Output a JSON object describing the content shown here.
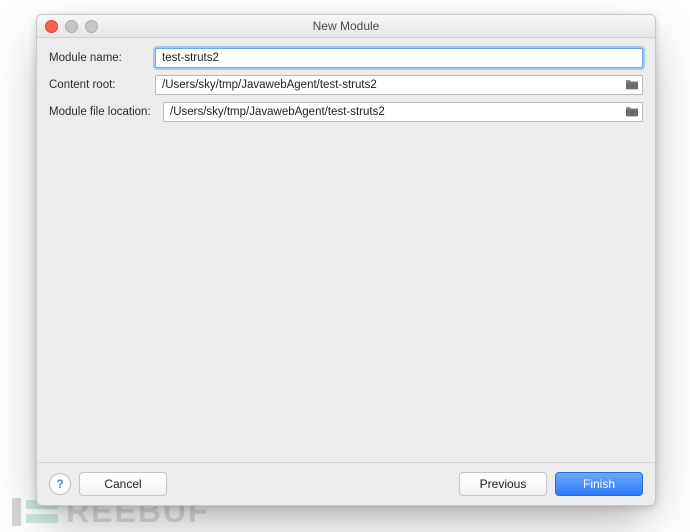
{
  "window": {
    "title": "New Module"
  },
  "form": {
    "module_name": {
      "label": "Module name:",
      "value": "test-struts2"
    },
    "content_root": {
      "label": "Content root:",
      "value": "/Users/sky/tmp/JavawebAgent/test-struts2"
    },
    "module_file_location": {
      "label": "Module file location:",
      "value": "/Users/sky/tmp/JavawebAgent/test-struts2"
    }
  },
  "footer": {
    "help": "?",
    "cancel": "Cancel",
    "previous": "Previous",
    "finish": "Finish"
  },
  "watermark": {
    "text": "REEBUF"
  }
}
